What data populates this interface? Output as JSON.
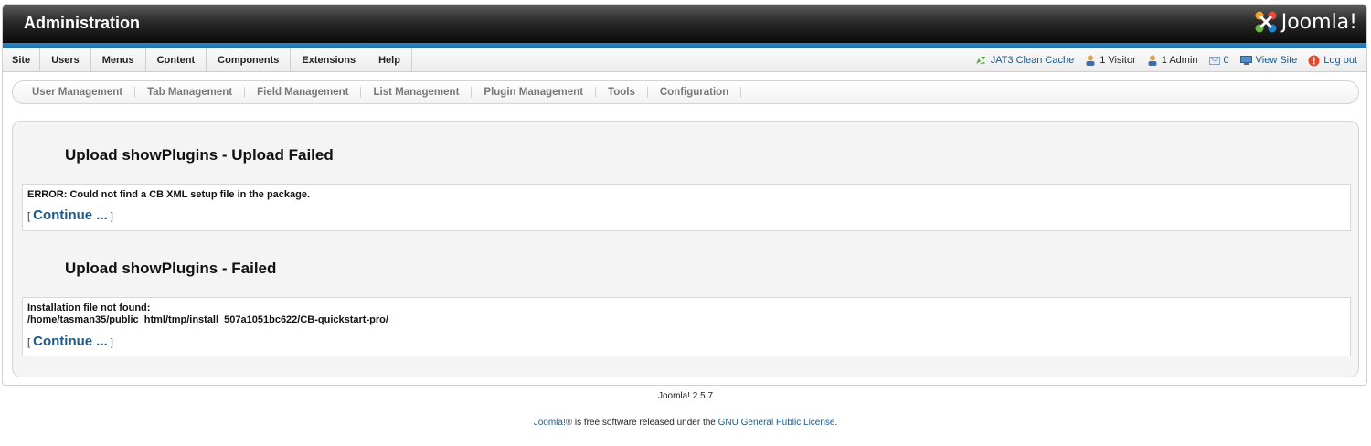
{
  "header": {
    "title": "Administration",
    "logo_text": "Joomla!",
    "colors": {
      "header_dark": "#0a0a0a",
      "accent_blue": "#2b86c4",
      "link": "#1b5a8a"
    }
  },
  "menubar": {
    "items": [
      "Site",
      "Users",
      "Menus",
      "Content",
      "Components",
      "Extensions",
      "Help"
    ]
  },
  "status": {
    "cache": "JAT3 Clean Cache",
    "visitors": "1 Visitor",
    "admins": "1 Admin",
    "messages": "0",
    "view_site": "View Site",
    "logout": "Log out"
  },
  "subnav": {
    "items": [
      "User Management",
      "Tab Management",
      "Field Management",
      "List Management",
      "Plugin Management",
      "Tools",
      "Configuration"
    ]
  },
  "sections": [
    {
      "heading": "Upload showPlugins - Upload Failed",
      "message_lines": [
        "ERROR: Could not find a CB XML setup file in the package."
      ],
      "continue_open": "[",
      "continue_label": "Continue ...",
      "continue_close": "]"
    },
    {
      "heading": "Upload showPlugins - Failed",
      "message_lines": [
        "Installation file not found:",
        "/home/tasman35/public_html/tmp/install_507a1051bc622/CB-quickstart-pro/"
      ],
      "continue_open": "[",
      "continue_label": "Continue ...",
      "continue_close": "]"
    }
  ],
  "footer": {
    "version": "Joomla! 2.5.7",
    "joomla_link": "Joomla!®",
    "license_text": " is free software released under the ",
    "license_link": "GNU General Public License",
    "license_end": "."
  }
}
